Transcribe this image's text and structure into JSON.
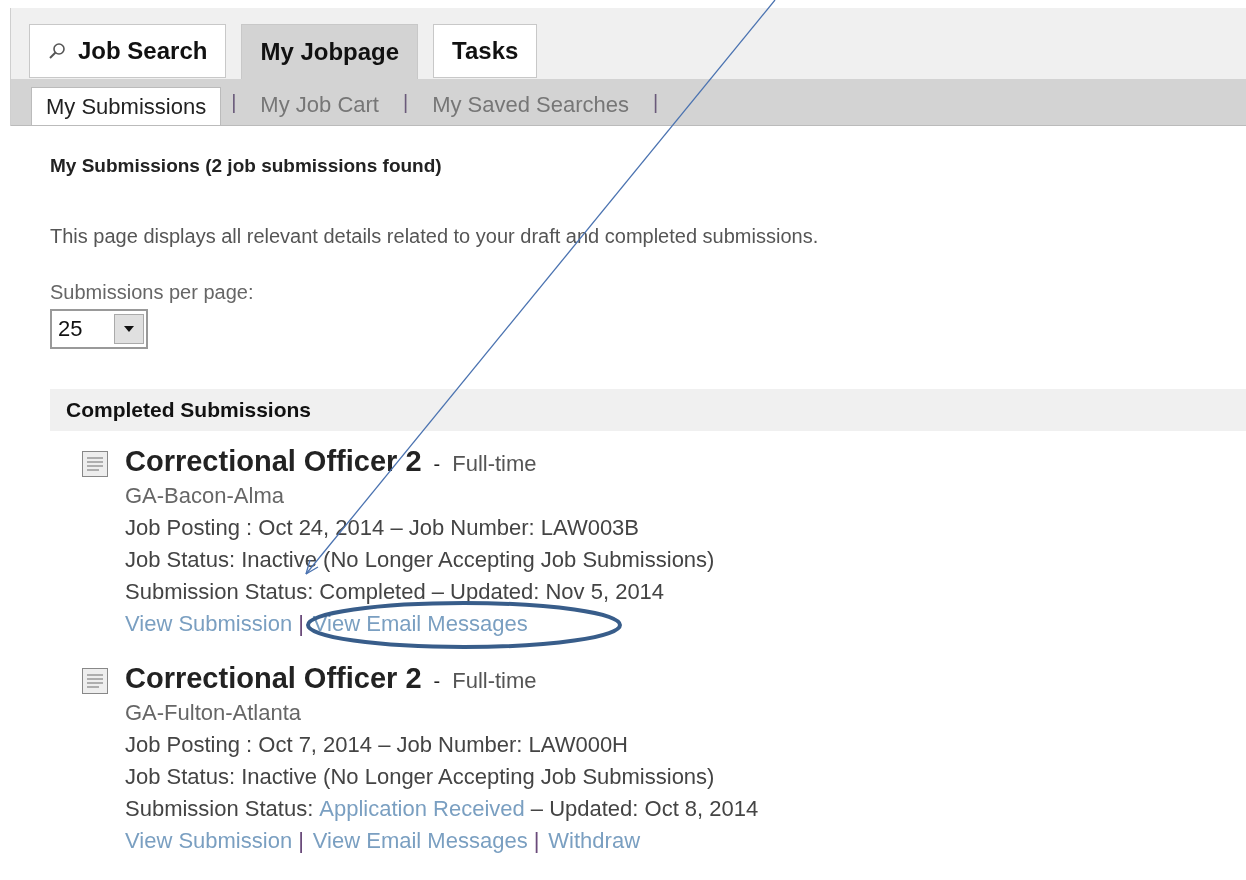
{
  "tabs": [
    {
      "label": "Job Search",
      "selected": false
    },
    {
      "label": "My Jobpage",
      "selected": true
    },
    {
      "label": "Tasks",
      "selected": false
    }
  ],
  "subtab_separator": "|",
  "link_separator": "|",
  "subtabs": [
    {
      "label": "My Submissions",
      "selected": true
    },
    {
      "label": "My Job Cart",
      "selected": false
    },
    {
      "label": "My Saved Searches",
      "selected": false
    }
  ],
  "heading": "My Submissions (2 job submissions found)",
  "description": "This page displays all relevant details related to your draft and completed submissions.",
  "per_page": {
    "label": "Submissions per page:",
    "value": "25"
  },
  "section_title": "Completed Submissions",
  "submissions": [
    {
      "title": "Correctional Officer 2",
      "separator": "-",
      "type": "Full-time",
      "location": "GA-Bacon-Alma",
      "posting": "Job Posting : Oct 24, 2014 – Job Number: LAW003B",
      "job_status": "Job Status: Inactive (No Longer Accepting Job Submissions)",
      "status_label": "Submission Status:",
      "status_link": false,
      "status_value": "Completed",
      "updated": "– Updated: Nov 5, 2014",
      "links": [
        "View Submission",
        "View Email Messages"
      ]
    },
    {
      "title": "Correctional Officer 2",
      "separator": "-",
      "type": "Full-time",
      "location": "GA-Fulton-Atlanta",
      "posting": "Job Posting : Oct 7, 2014 – Job Number: LAW000H",
      "job_status": "Job Status: Inactive (No Longer Accepting Job Submissions)",
      "status_label": "Submission Status:",
      "status_link": true,
      "status_value": "Application Received",
      "updated": "– Updated: Oct 8, 2014",
      "links": [
        "View Submission",
        "View Email Messages",
        "Withdraw"
      ]
    }
  ]
}
